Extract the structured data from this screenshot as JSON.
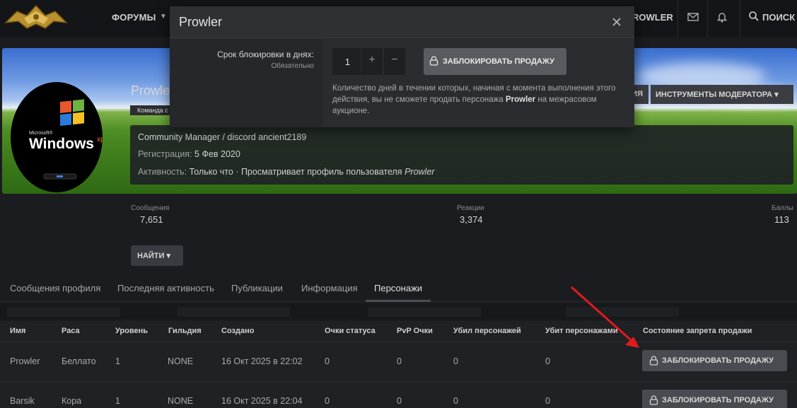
{
  "nav": {
    "forums": "ФОРУМЫ",
    "user": "ROWLER",
    "search": "ПОИСК"
  },
  "profile": {
    "name": "Prowle",
    "badge": "Команда с",
    "mod_button_1": "ЗИЯ",
    "mod_button_2": "ИНСТРУМЕНТЫ МОДЕРАТОРА ▾",
    "title": "Community Manager / discord ancient2189",
    "reg_label": "Регистрация:",
    "reg_value": "5 Фев 2020",
    "activity_label": "Активность:",
    "activity_value": "Только что · Просматривает профиль пользователя",
    "activity_user": "Prowler"
  },
  "stats": {
    "messages_label": "Сообщения",
    "messages_value": "7,651",
    "reactions_label": "Реакции",
    "reactions_value": "3,374",
    "points_label": "Баллы",
    "points_value": "113"
  },
  "find_button": "НАЙТИ ▾",
  "tabs": [
    "Сообщения профиля",
    "Последняя активность",
    "Публикации",
    "Информация",
    "Персонажи"
  ],
  "table": {
    "headers": [
      "Имя",
      "Раса",
      "Уровень",
      "Гильдия",
      "Создано",
      "Очки статуса",
      "PvP Очки",
      "Убил персонажей",
      "Убит персонажами",
      "Состояние запрета продажи"
    ],
    "rows": [
      {
        "name": "Prowler",
        "race": "Беллато",
        "level": "1",
        "guild": "NONE",
        "created": "16 Окт 2025 в 22:02",
        "status": "0",
        "pvp": "0",
        "killed": "0",
        "killed_by": "0",
        "action": "ЗАБЛОКИРОВАТЬ ПРОДАЖУ"
      },
      {
        "name": "Barsik",
        "race": "Кора",
        "level": "1",
        "guild": "NONE",
        "created": "16 Окт 2025 в 22:04",
        "status": "0",
        "pvp": "0",
        "killed": "0",
        "killed_by": "0",
        "action": "ЗАБЛОКИРОВАТЬ ПРОДАЖУ"
      }
    ]
  },
  "modal": {
    "title": "Prowler",
    "field_label": "Срок блокировки в днях:",
    "field_required": "Обязательно",
    "input_value": "1",
    "plus": "+",
    "minus": "−",
    "button": "ЗАБЛОКИРОВАТЬ ПРОДАЖУ",
    "help_1": "Количество дней в течении которых, начиная с момента выполнения этого действия, вы не сможете продать персонажа ",
    "help_name": "Prowler",
    "help_2": " на межрасовом аукционе."
  },
  "icons": {
    "logo": "winged-emblem-logo",
    "mail": "envelope-icon",
    "bell": "bell-icon",
    "search": "search-icon",
    "lock": "lock-icon",
    "close": "close-icon",
    "annotation": "red-arrow"
  },
  "avatar_text": {
    "microsoft": "Microsoft®",
    "windows": "Windows",
    "xp": "xp"
  }
}
